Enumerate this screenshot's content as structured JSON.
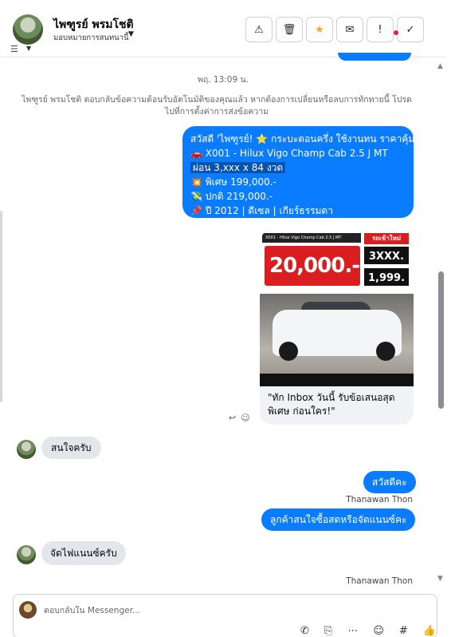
{
  "header": {
    "contact_name": "ไพฑูรย์ พรมโชติ",
    "assign_label": "มอบหมายการสนทนานี้",
    "toolbar_icons": [
      "warning-icon",
      "trash-icon",
      "star-icon",
      "mail-icon",
      "priority-icon",
      "check-icon"
    ]
  },
  "conversation": {
    "time_separator": "พฤ. 13:09 น.",
    "system_notice": "ไพฑูรย์ พรมโชติ ตอบกลับข้อความต้อนรับอัตโนมัติของคุณแล้ว หากต้องการเปลี่ยนหรือลบการทักทายนี้ โปรดไปที่การตั้งค่าการส่งข้อความ",
    "main_message": {
      "line1": "สวัสดี 'ไพฑูรย์! ⭐ กระบะตอนครึ่ง ใช้งานทน ราคาคุ้ม",
      "line2": "🚗 X001 - Hilux Vigo Champ Cab 2.5 J MT",
      "line3": "ผ่อน 3,xxx x 84 งวด",
      "line4": "💥 พิเศษ 199,000.-",
      "line5": "💸 ปกติ 219,000.-",
      "line6": "📌 ปี 2012 | ดีเซล | เกียร์ธรรมดา"
    },
    "card": {
      "banner_top": "X001 - Hilux Vigo Champ Cab 2.5 J MT",
      "banner_price": "20,000.-",
      "banner_new": "รถเข้าใหม่",
      "banner_box1": "3XXX.",
      "banner_box2": "1,999.",
      "caption": "\"ทัก Inbox วันนี้ รับข้อเสนอสุดพิเศษ ก่อนใคร!\""
    },
    "messages": [
      {
        "direction": "in",
        "text": "สนใจครับ"
      },
      {
        "direction": "out",
        "text": "สวัสดีคะ"
      },
      {
        "direction": "out",
        "text": "ลูกค้าสนใจซื้อสดหรือจัดแนนซ์คะ"
      },
      {
        "direction": "in",
        "text": "จัดไฟแนนซ์ครับ"
      }
    ],
    "sender_label_1": "Thanawan Thon",
    "sender_label_2": "Thanawan Thon"
  },
  "composer": {
    "placeholder": "ตอบกลับใน Messenger...",
    "tool_icons": [
      "call-icon",
      "attach-icon",
      "more-icon",
      "emoji-icon",
      "hashtag-icon",
      "like-icon"
    ]
  },
  "colors": {
    "outgoing_bubble": "#0a7cff",
    "incoming_bubble": "#e4e6eb",
    "star": "#f5a623"
  }
}
